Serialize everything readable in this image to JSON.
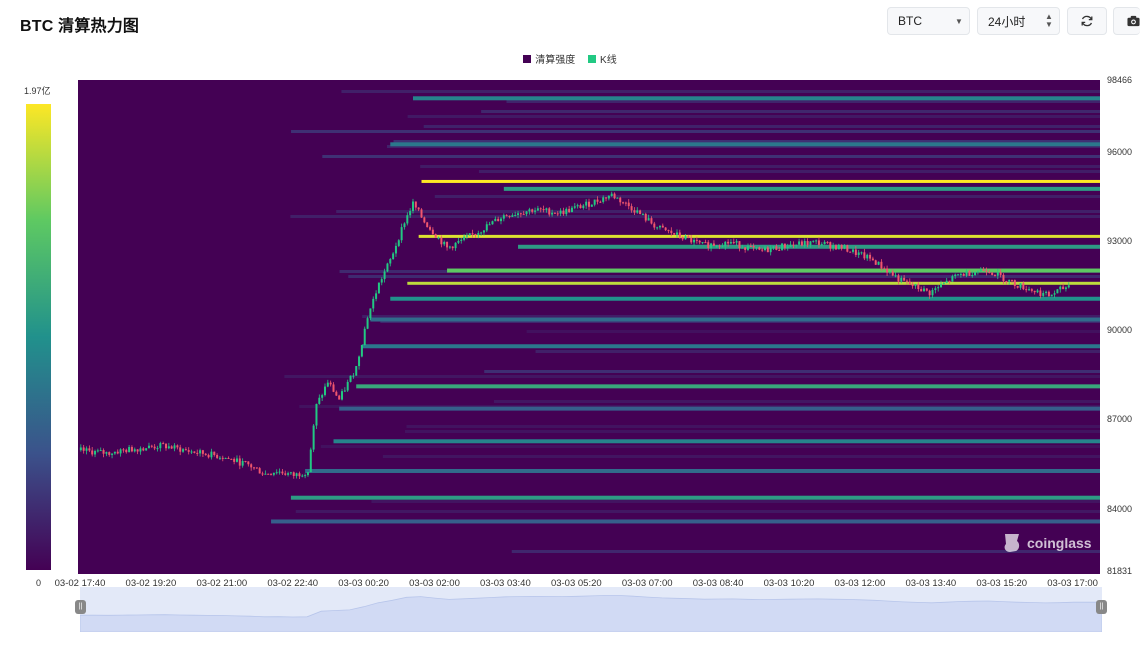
{
  "header": {
    "title": "BTC 清算热力图"
  },
  "controls": {
    "symbol": "BTC",
    "range": "24小时",
    "refresh_icon": "refresh-icon",
    "camera_icon": "camera-icon"
  },
  "legend": [
    {
      "label": "清算强度",
      "color": "#440154"
    },
    {
      "label": "K线",
      "color": "#22c983"
    }
  ],
  "colorbar": {
    "max_label": "1.97亿",
    "min_label": "0"
  },
  "watermark": "coinglass",
  "chart_data": {
    "type": "heatmap",
    "title": "",
    "ylim": [
      81831,
      98466
    ],
    "y_ticks": [
      "98466",
      "96000",
      "93000",
      "90000",
      "87000",
      "84000",
      "81831"
    ],
    "x_ticks": [
      "03-02 17:40",
      "03-02 19:20",
      "03-02 21:00",
      "03-02 22:40",
      "03-03 00:20",
      "03-03 02:00",
      "03-03 03:40",
      "03-03 05:20",
      "03-03 07:00",
      "03-03 08:40",
      "03-03 10:20",
      "03-03 12:00",
      "03-03 13:40",
      "03-03 15:20",
      "03-03 17:00"
    ],
    "x_range": [
      "03-02 17:40",
      "03-03 17:40"
    ],
    "colorbar_range": [
      0,
      "1.97亿"
    ],
    "price_path_hours": [
      [
        0,
        86000
      ],
      [
        1,
        85900
      ],
      [
        2,
        86050
      ],
      [
        3,
        86150
      ],
      [
        4,
        85950
      ],
      [
        5,
        85800
      ],
      [
        6,
        85500
      ],
      [
        6.6,
        85200
      ],
      [
        7,
        85300
      ],
      [
        7.6,
        85150
      ],
      [
        8.1,
        85300
      ],
      [
        8.4,
        87500
      ],
      [
        8.8,
        88300
      ],
      [
        9.2,
        87700
      ],
      [
        9.8,
        88800
      ],
      [
        10.2,
        90500
      ],
      [
        10.6,
        91600
      ],
      [
        11,
        92400
      ],
      [
        11.5,
        93700
      ],
      [
        11.8,
        94300
      ],
      [
        12.2,
        93700
      ],
      [
        13,
        92800
      ],
      [
        14,
        93300
      ],
      [
        15,
        93900
      ],
      [
        16,
        94100
      ],
      [
        17,
        94000
      ],
      [
        18,
        94300
      ],
      [
        18.8,
        94600
      ],
      [
        19.6,
        94100
      ],
      [
        20.4,
        93500
      ],
      [
        21.2,
        93200
      ],
      [
        22,
        92900
      ],
      [
        23,
        93000
      ],
      [
        24,
        92700
      ],
      [
        25,
        92900
      ],
      [
        26,
        93000
      ],
      [
        27,
        92800
      ],
      [
        28,
        92400
      ],
      [
        29,
        91700
      ],
      [
        30,
        91300
      ],
      [
        31,
        91900
      ],
      [
        32,
        92100
      ],
      [
        33,
        91600
      ],
      [
        34.2,
        91200
      ],
      [
        35,
        91600
      ]
    ],
    "liquidation_levels": [
      {
        "price": 95050,
        "start_hour": 12.1,
        "intensity": 1.0
      },
      {
        "price": 93200,
        "start_hour": 12.0,
        "intensity": 0.95
      },
      {
        "price": 91620,
        "start_hour": 11.6,
        "intensity": 0.9
      },
      {
        "price": 92050,
        "start_hour": 13.0,
        "intensity": 0.75
      },
      {
        "price": 94800,
        "start_hour": 15.0,
        "intensity": 0.55
      },
      {
        "price": 92850,
        "start_hour": 15.5,
        "intensity": 0.55
      },
      {
        "price": 91100,
        "start_hour": 11.0,
        "intensity": 0.5
      },
      {
        "price": 88150,
        "start_hour": 9.8,
        "intensity": 0.6
      },
      {
        "price": 84400,
        "start_hour": 7.5,
        "intensity": 0.55
      },
      {
        "price": 86300,
        "start_hour": 9.0,
        "intensity": 0.45
      },
      {
        "price": 97850,
        "start_hour": 11.8,
        "intensity": 0.45
      },
      {
        "price": 96300,
        "start_hour": 11.0,
        "intensity": 0.4
      },
      {
        "price": 89500,
        "start_hour": 10.0,
        "intensity": 0.4
      },
      {
        "price": 90400,
        "start_hour": 10.3,
        "intensity": 0.35
      },
      {
        "price": 85300,
        "start_hour": 8.0,
        "intensity": 0.35
      },
      {
        "price": 83600,
        "start_hour": 6.8,
        "intensity": 0.3
      },
      {
        "price": 87400,
        "start_hour": 9.2,
        "intensity": 0.3
      }
    ]
  },
  "navigator": {
    "left_handle": "nav-left-handle",
    "right_handle": "nav-right-handle"
  }
}
